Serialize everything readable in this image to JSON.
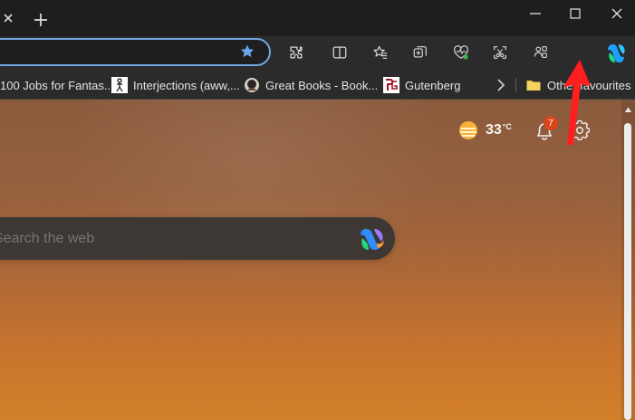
{
  "search": {
    "placeholder": "Search the web"
  },
  "bookmarks": [
    {
      "label": "100 Jobs for Fantas..."
    },
    {
      "label": "Interjections (aww,..."
    },
    {
      "label": "Great Books - Book..."
    },
    {
      "label": "Gutenberg"
    },
    {
      "label": "Other favourites"
    }
  ],
  "header": {
    "temperature": "33",
    "temperature_unit": "°C",
    "notification_count": "7"
  },
  "colors": {
    "accent": "#6ea6df",
    "badge": "#d9461d",
    "annotation": "#ff1f1f"
  },
  "icons": {
    "tab": "close-icon",
    "window": [
      "minimize-icon",
      "maximize-icon",
      "close-icon"
    ],
    "toolbar": [
      "favorite-star-icon",
      "extensions-icon",
      "split-screen-icon",
      "favorites-icon",
      "collections-icon",
      "browser-essentials-icon",
      "screenshot-icon",
      "workspaces-icon",
      "more-icon",
      "copilot-icon"
    ],
    "content": [
      "sun-icon",
      "bell-icon",
      "gear-icon",
      "copilot-icon"
    ],
    "annotation": "red-arrow-icon"
  }
}
